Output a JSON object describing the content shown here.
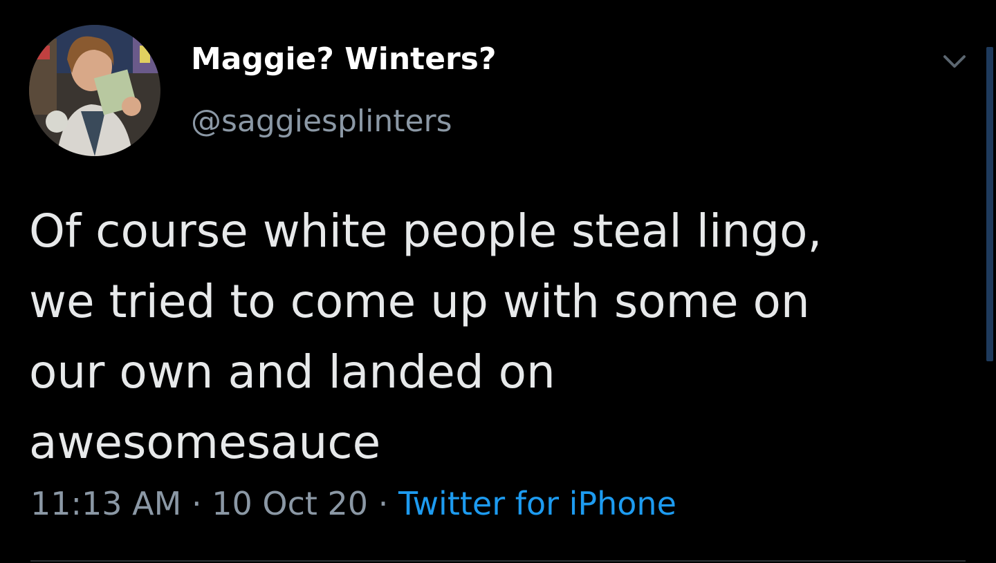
{
  "author": {
    "display_name": "Maggie? Winters?",
    "handle": "@saggiesplinters"
  },
  "tweet": {
    "text": "Of course white people steal lingo, we tried to come up with some on our own and landed on awesomesauce",
    "time": "11:13 AM",
    "separator": "·",
    "date": "10 Oct 20",
    "source": "Twitter for iPhone"
  },
  "icons": {
    "menu": "chevron-down-icon"
  },
  "colors": {
    "background": "#000000",
    "text": "#e7e9ea",
    "secondary": "#8b98a5",
    "accent": "#1d9bf0"
  }
}
